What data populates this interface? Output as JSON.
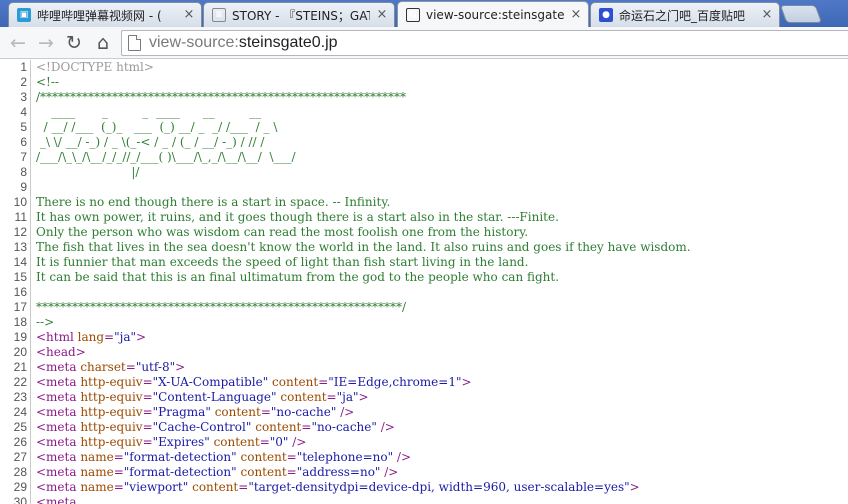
{
  "browser": {
    "tabs": [
      {
        "title": "哔哩哔哩弹幕视频网 - (",
        "favicon": "bilibili-icon",
        "active": false
      },
      {
        "title": "STORY - 『STEINS；GAT",
        "favicon": "document-icon",
        "active": false
      },
      {
        "title": "view-source:steinsgate0",
        "favicon": "g-icon",
        "active": true
      },
      {
        "title": "命运石之门吧_百度贴吧",
        "favicon": "baidu-paw-icon",
        "active": false
      }
    ],
    "tab_close_glyph": "×",
    "url_scheme": "view-source:",
    "url_host": "steinsgate0.jp"
  },
  "source_lines": [
    {
      "n": "1",
      "parts": [
        [
          "doctype",
          "<!DOCTYPE html>"
        ]
      ]
    },
    {
      "n": "2",
      "parts": [
        [
          "comment",
          "<!--"
        ]
      ]
    },
    {
      "n": "3",
      "parts": [
        [
          "comment",
          "/*************************************************************"
        ]
      ]
    },
    {
      "n": "4",
      "parts": [
        [
          "comment",
          "    ____       _         _  ____      __         __"
        ]
      ]
    },
    {
      "n": "5",
      "parts": [
        [
          "comment",
          "  / __/ /___  (_)_   ___  (_) __/ _  _/ /___  / _ \\"
        ]
      ]
    },
    {
      "n": "6",
      "parts": [
        [
          "comment",
          " _\\ \\/ __/ -_) / _ \\(_-< / _ / (_ / __/ -_) / // /"
        ]
      ]
    },
    {
      "n": "7",
      "parts": [
        [
          "comment",
          "/___/\\_\\_/\\__/_/_//_/___( )\\___/\\_,_/\\__/\\__/  \\___/"
        ]
      ]
    },
    {
      "n": "8",
      "parts": [
        [
          "comment",
          "                         |/"
        ]
      ]
    },
    {
      "n": "9",
      "parts": [
        [
          "comment",
          ""
        ]
      ]
    },
    {
      "n": "10",
      "parts": [
        [
          "comment",
          "There is no end though there is a start in space. -- Infinity."
        ]
      ]
    },
    {
      "n": "11",
      "parts": [
        [
          "comment",
          "It has own power, it ruins, and it goes though there is a start also in the star. ---Finite."
        ]
      ]
    },
    {
      "n": "12",
      "parts": [
        [
          "comment",
          "Only the person who was wisdom can read the most foolish one from the history."
        ]
      ]
    },
    {
      "n": "13",
      "parts": [
        [
          "comment",
          "The fish that lives in the sea doesn't know the world in the land. It also ruins and goes if they have wisdom."
        ]
      ]
    },
    {
      "n": "14",
      "parts": [
        [
          "comment",
          "It is funnier that man exceeds the speed of light than fish start living in the land."
        ]
      ]
    },
    {
      "n": "15",
      "parts": [
        [
          "comment",
          "It can be said that this is an final ultimatum from the god to the people who can fight."
        ]
      ]
    },
    {
      "n": "16",
      "parts": [
        [
          "comment",
          ""
        ]
      ]
    },
    {
      "n": "17",
      "parts": [
        [
          "comment",
          "*************************************************************/"
        ]
      ]
    },
    {
      "n": "18",
      "parts": [
        [
          "comment",
          "-->"
        ]
      ]
    },
    {
      "n": "19",
      "parts": [
        [
          "tag",
          "<html "
        ],
        [
          "attr",
          "lang"
        ],
        [
          "tag",
          "="
        ],
        [
          "val",
          "\"ja\""
        ],
        [
          "tag",
          ">"
        ]
      ]
    },
    {
      "n": "20",
      "parts": [
        [
          "tag",
          "<head>"
        ]
      ]
    },
    {
      "n": "21",
      "parts": [
        [
          "tag",
          "<meta "
        ],
        [
          "attr",
          "charset"
        ],
        [
          "tag",
          "="
        ],
        [
          "val",
          "\"utf-8\""
        ],
        [
          "tag",
          ">"
        ]
      ]
    },
    {
      "n": "22",
      "parts": [
        [
          "tag",
          "<meta "
        ],
        [
          "attr",
          "http-equiv"
        ],
        [
          "tag",
          "="
        ],
        [
          "val",
          "\"X-UA-Compatible\""
        ],
        [
          "tag",
          " "
        ],
        [
          "attr",
          "content"
        ],
        [
          "tag",
          "="
        ],
        [
          "val",
          "\"IE=Edge,chrome=1\""
        ],
        [
          "tag",
          ">"
        ]
      ]
    },
    {
      "n": "23",
      "parts": [
        [
          "tag",
          "<meta "
        ],
        [
          "attr",
          "http-equiv"
        ],
        [
          "tag",
          "="
        ],
        [
          "val",
          "\"Content-Language\""
        ],
        [
          "tag",
          " "
        ],
        [
          "attr",
          "content"
        ],
        [
          "tag",
          "="
        ],
        [
          "val",
          "\"ja\""
        ],
        [
          "tag",
          ">"
        ]
      ]
    },
    {
      "n": "24",
      "parts": [
        [
          "tag",
          "<meta "
        ],
        [
          "attr",
          "http-equiv"
        ],
        [
          "tag",
          "="
        ],
        [
          "val",
          "\"Pragma\""
        ],
        [
          "tag",
          " "
        ],
        [
          "attr",
          "content"
        ],
        [
          "tag",
          "="
        ],
        [
          "val",
          "\"no-cache\""
        ],
        [
          "tag",
          " />"
        ]
      ]
    },
    {
      "n": "25",
      "parts": [
        [
          "tag",
          "<meta "
        ],
        [
          "attr",
          "http-equiv"
        ],
        [
          "tag",
          "="
        ],
        [
          "val",
          "\"Cache-Control\""
        ],
        [
          "tag",
          " "
        ],
        [
          "attr",
          "content"
        ],
        [
          "tag",
          "="
        ],
        [
          "val",
          "\"no-cache\""
        ],
        [
          "tag",
          " />"
        ]
      ]
    },
    {
      "n": "26",
      "parts": [
        [
          "tag",
          "<meta "
        ],
        [
          "attr",
          "http-equiv"
        ],
        [
          "tag",
          "="
        ],
        [
          "val",
          "\"Expires\""
        ],
        [
          "tag",
          " "
        ],
        [
          "attr",
          "content"
        ],
        [
          "tag",
          "="
        ],
        [
          "val",
          "\"0\""
        ],
        [
          "tag",
          " />"
        ]
      ]
    },
    {
      "n": "27",
      "parts": [
        [
          "tag",
          "<meta "
        ],
        [
          "attr",
          "name"
        ],
        [
          "tag",
          "="
        ],
        [
          "val",
          "\"format-detection\""
        ],
        [
          "tag",
          " "
        ],
        [
          "attr",
          "content"
        ],
        [
          "tag",
          "="
        ],
        [
          "val",
          "\"telephone=no\""
        ],
        [
          "tag",
          " />"
        ]
      ]
    },
    {
      "n": "28",
      "parts": [
        [
          "tag",
          "<meta "
        ],
        [
          "attr",
          "name"
        ],
        [
          "tag",
          "="
        ],
        [
          "val",
          "\"format-detection\""
        ],
        [
          "tag",
          " "
        ],
        [
          "attr",
          "content"
        ],
        [
          "tag",
          "="
        ],
        [
          "val",
          "\"address=no\""
        ],
        [
          "tag",
          " />"
        ]
      ]
    },
    {
      "n": "29",
      "parts": [
        [
          "tag",
          "<meta "
        ],
        [
          "attr",
          "name"
        ],
        [
          "tag",
          "="
        ],
        [
          "val",
          "\"viewport\""
        ],
        [
          "tag",
          " "
        ],
        [
          "attr",
          "content"
        ],
        [
          "tag",
          "="
        ],
        [
          "val",
          "\"target-densitydpi=device-dpi, width=960, user-scalable=yes\""
        ],
        [
          "tag",
          ">"
        ]
      ]
    },
    {
      "n": "30",
      "parts": [
        [
          "tag",
          "<meta "
        ]
      ]
    }
  ]
}
